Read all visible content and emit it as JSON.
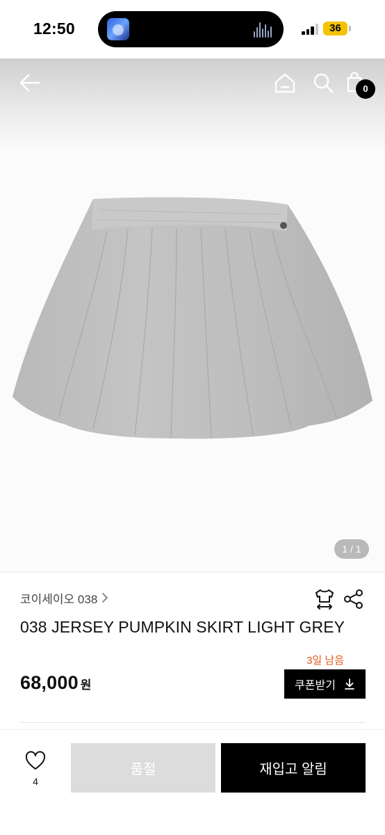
{
  "status_bar": {
    "time": "12:50",
    "battery": "36",
    "icons": [
      "now-playing-art-icon",
      "audio-wave-icon",
      "cellular-signal-icon",
      "battery-icon"
    ]
  },
  "nav": {
    "icons": [
      "back-arrow-icon",
      "home-icon",
      "search-icon",
      "shopping-bag-icon"
    ],
    "bag_count": "0"
  },
  "gallery": {
    "counter": "1 / 1"
  },
  "product": {
    "brand": "코이세이오 038",
    "title": "038 JERSEY PUMPKIN SKIRT LIGHT GREY",
    "days_left": "3일 남음",
    "price": "68,000",
    "currency": "원",
    "coupon_label": "쿠폰받기",
    "icons": [
      "size-guide-icon",
      "share-icon",
      "chevron-right-icon",
      "download-icon"
    ]
  },
  "bottom_bar": {
    "like_count": "4",
    "soldout_label": "품절",
    "restock_label": "재입고 알림",
    "icons": [
      "heart-icon"
    ]
  },
  "colors": {
    "accent_orange": "#e0581b",
    "primary_black": "#000000",
    "disabled_grey": "#dcdcdc",
    "battery_yellow": "#f4c200"
  }
}
